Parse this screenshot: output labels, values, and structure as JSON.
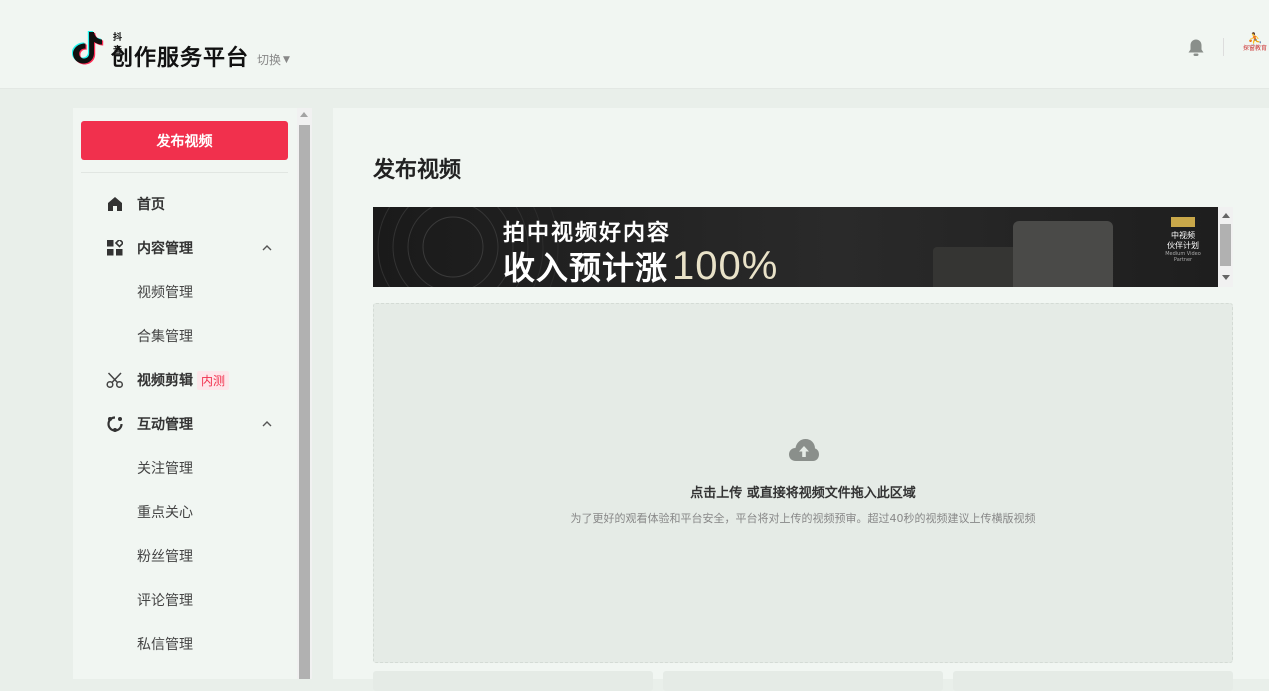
{
  "header": {
    "brand_small": "抖音",
    "brand_big": "创作服务平台",
    "switch_label": "切换",
    "avatar_text": "探窗教育"
  },
  "sidebar": {
    "publish_label": "发布视频",
    "items": [
      {
        "label": "首页",
        "icon": "home-icon"
      },
      {
        "label": "内容管理",
        "icon": "content-grid-icon",
        "expanded": true
      },
      {
        "label": "视频管理"
      },
      {
        "label": "合集管理"
      },
      {
        "label": "视频剪辑",
        "icon": "scissors-icon",
        "badge": "内测"
      },
      {
        "label": "互动管理",
        "icon": "interact-icon",
        "expanded": true
      },
      {
        "label": "关注管理"
      },
      {
        "label": "重点关心"
      },
      {
        "label": "粉丝管理"
      },
      {
        "label": "评论管理"
      },
      {
        "label": "私信管理"
      }
    ]
  },
  "main": {
    "title": "发布视频",
    "banner": {
      "line1": "拍中视频好内容",
      "line2": "收入预计涨",
      "line2_pct": "100%",
      "plan_title": "中视频\n伙伴计划",
      "plan_sub": "Medium Video Partner"
    },
    "upload": {
      "main_text": "点击上传 或直接将视频文件拖入此区域",
      "hint": "为了更好的观看体验和平台安全，平台将对上传的视频预审。超过40秒的视频建议上传横版视频"
    }
  },
  "colors": {
    "accent": "#f1304d",
    "background": "#e9efea",
    "panel": "#f1f6f2"
  }
}
